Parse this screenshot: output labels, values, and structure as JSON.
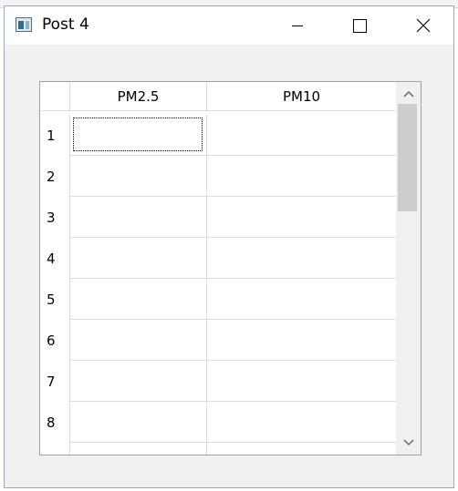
{
  "window": {
    "title": "Post 4"
  },
  "table": {
    "columns": [
      "PM2.5",
      "PM10"
    ],
    "rows": [
      "1",
      "2",
      "3",
      "4",
      "5",
      "6",
      "7",
      "8"
    ]
  },
  "icons": {
    "minimize": "minimize-icon",
    "maximize": "maximize-icon",
    "close": "close-icon",
    "scroll_up": "chevron-up-icon",
    "scroll_down": "chevron-down-icon"
  }
}
